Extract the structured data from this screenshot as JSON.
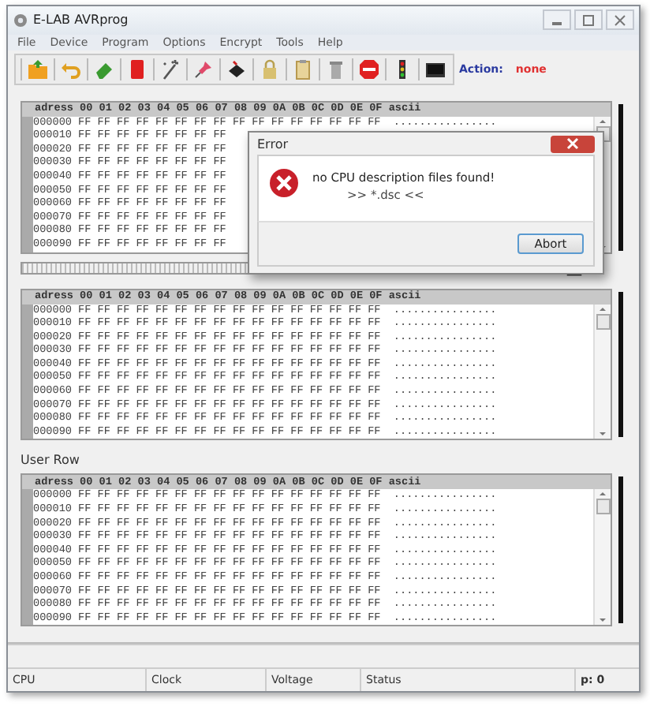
{
  "window": {
    "title": "E-LAB AVRprog"
  },
  "menu": [
    "File",
    "Device",
    "Program",
    "Options",
    "Encrypt",
    "Tools",
    "Help"
  ],
  "action": {
    "label": "Action:",
    "value": "none"
  },
  "panels": [
    {
      "header": "adress 00 01 02 03 04 05 06 07 08 09 0A 0B 0C 0D 0E 0F ascii",
      "rows": [
        {
          "address": "000000",
          "hex": "FF FF FF FF FF FF FF FF FF FF FF FF FF FF FF FF",
          "ascii": "................"
        },
        {
          "address": "000010",
          "hex": "FF FF FF FF FF FF FF FF"
        },
        {
          "address": "000020",
          "hex": "FF FF FF FF FF FF FF FF"
        },
        {
          "address": "000030",
          "hex": "FF FF FF FF FF FF FF FF"
        },
        {
          "address": "000040",
          "hex": "FF FF FF FF FF FF FF FF"
        },
        {
          "address": "000050",
          "hex": "FF FF FF FF FF FF FF FF"
        },
        {
          "address": "000060",
          "hex": "FF FF FF FF FF FF FF FF"
        },
        {
          "address": "000070",
          "hex": "FF FF FF FF FF FF FF FF"
        },
        {
          "address": "000080",
          "hex": "FF FF FF FF FF FF FF FF"
        },
        {
          "address": "000090",
          "hex": "FF FF FF FF FF FF FF FF"
        }
      ]
    },
    {
      "header": "adress 00 01 02 03 04 05 06 07 08 09 0A 0B 0C 0D 0E 0F ascii",
      "rows": [
        {
          "address": "000000",
          "hex": "FF FF FF FF FF FF FF FF FF FF FF FF FF FF FF FF",
          "ascii": "................"
        },
        {
          "address": "000010",
          "hex": "FF FF FF FF FF FF FF FF FF FF FF FF FF FF FF FF",
          "ascii": "................"
        },
        {
          "address": "000020",
          "hex": "FF FF FF FF FF FF FF FF FF FF FF FF FF FF FF FF",
          "ascii": "................"
        },
        {
          "address": "000030",
          "hex": "FF FF FF FF FF FF FF FF FF FF FF FF FF FF FF FF",
          "ascii": "................"
        },
        {
          "address": "000040",
          "hex": "FF FF FF FF FF FF FF FF FF FF FF FF FF FF FF FF",
          "ascii": "................"
        },
        {
          "address": "000050",
          "hex": "FF FF FF FF FF FF FF FF FF FF FF FF FF FF FF FF",
          "ascii": "................"
        },
        {
          "address": "000060",
          "hex": "FF FF FF FF FF FF FF FF FF FF FF FF FF FF FF FF",
          "ascii": "................"
        },
        {
          "address": "000070",
          "hex": "FF FF FF FF FF FF FF FF FF FF FF FF FF FF FF FF",
          "ascii": "................"
        },
        {
          "address": "000080",
          "hex": "FF FF FF FF FF FF FF FF FF FF FF FF FF FF FF FF",
          "ascii": "................"
        },
        {
          "address": "000090",
          "hex": "FF FF FF FF FF FF FF FF FF FF FF FF FF FF FF FF",
          "ascii": "................"
        }
      ]
    },
    {
      "label": "User Row",
      "header": "adress 00 01 02 03 04 05 06 07 08 09 0A 0B 0C 0D 0E 0F ascii",
      "rows": [
        {
          "address": "000000",
          "hex": "FF FF FF FF FF FF FF FF FF FF FF FF FF FF FF FF",
          "ascii": "................"
        },
        {
          "address": "000010",
          "hex": "FF FF FF FF FF FF FF FF FF FF FF FF FF FF FF FF",
          "ascii": "................"
        },
        {
          "address": "000020",
          "hex": "FF FF FF FF FF FF FF FF FF FF FF FF FF FF FF FF",
          "ascii": "................"
        },
        {
          "address": "000030",
          "hex": "FF FF FF FF FF FF FF FF FF FF FF FF FF FF FF FF",
          "ascii": "................"
        },
        {
          "address": "000040",
          "hex": "FF FF FF FF FF FF FF FF FF FF FF FF FF FF FF FF",
          "ascii": "................"
        },
        {
          "address": "000050",
          "hex": "FF FF FF FF FF FF FF FF FF FF FF FF FF FF FF FF",
          "ascii": "................"
        },
        {
          "address": "000060",
          "hex": "FF FF FF FF FF FF FF FF FF FF FF FF FF FF FF FF",
          "ascii": "................"
        },
        {
          "address": "000070",
          "hex": "FF FF FF FF FF FF FF FF FF FF FF FF FF FF FF FF",
          "ascii": "................"
        },
        {
          "address": "000080",
          "hex": "FF FF FF FF FF FF FF FF FF FF FF FF FF FF FF FF",
          "ascii": "................"
        },
        {
          "address": "000090",
          "hex": "FF FF FF FF FF FF FF FF FF FF FF FF FF FF FF FF",
          "ascii": "................"
        }
      ]
    }
  ],
  "dialog": {
    "title": "Error",
    "message": "no CPU description files found!",
    "detail": ">> *.dsc <<",
    "button": "Abort"
  },
  "status_bar": [
    "CPU",
    "Clock",
    "Voltage",
    "Status",
    "p: 0"
  ]
}
